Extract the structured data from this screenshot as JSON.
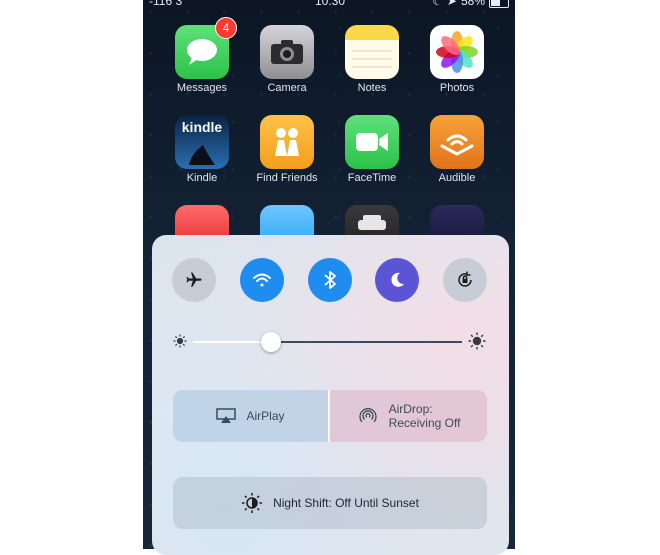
{
  "status_bar": {
    "carrier": "-116 3",
    "time": "10:30",
    "battery": "58%",
    "battery_level": 0.58
  },
  "apps": [
    {
      "label": "Messages",
      "badge": "4",
      "color": "#34c759"
    },
    {
      "label": "Camera",
      "color": "#8e8e93"
    },
    {
      "label": "Notes",
      "color": "#fbd74a"
    },
    {
      "label": "Photos",
      "color": "#ffffff"
    },
    {
      "label": "Kindle",
      "icon_text": "kindle",
      "color": "#1b3a66"
    },
    {
      "label": "Find Friends",
      "color": "#f6a623"
    },
    {
      "label": "FaceTime",
      "color": "#34c759"
    },
    {
      "label": "Audible",
      "color": "#f28c1e"
    }
  ],
  "control_center": {
    "toggles": [
      {
        "name": "airplane",
        "state": "off"
      },
      {
        "name": "wifi",
        "state": "on",
        "color": "#1f8cf0"
      },
      {
        "name": "bluetooth",
        "state": "on",
        "color": "#1f8cf0"
      },
      {
        "name": "do-not-disturb",
        "state": "on",
        "color": "#5b55d6"
      },
      {
        "name": "rotation-lock",
        "state": "off"
      }
    ],
    "brightness": 0.29,
    "airplay_label": "AirPlay",
    "airdrop_label_1": "AirDrop:",
    "airdrop_label_2": "Receiving Off",
    "night_shift_label": "Night Shift: Off Until Sunset"
  }
}
